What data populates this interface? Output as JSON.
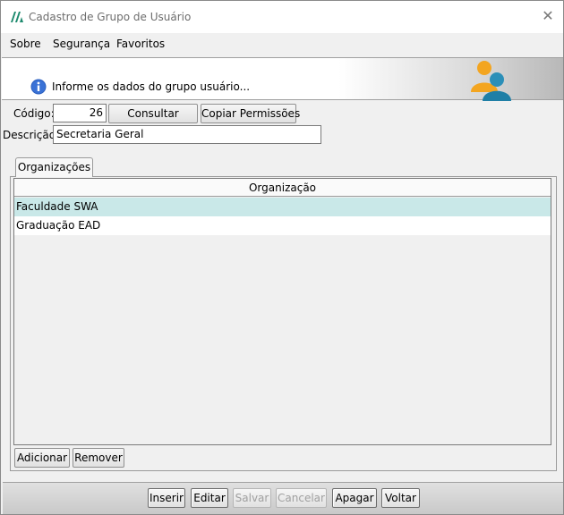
{
  "window": {
    "title": "Cadastro de Grupo de Usuário"
  },
  "menu": [
    {
      "label": "Sobre"
    },
    {
      "label": "Segurança"
    },
    {
      "label": "Favoritos"
    }
  ],
  "banner": {
    "text": "Informe os dados do grupo usuário..."
  },
  "form": {
    "codigo_label": "Código:",
    "codigo_value": "26",
    "consultar_label": "Consultar",
    "copiar_label": "Copiar Permissões",
    "descricao_label": "Descrição:",
    "descricao_value": "Secretaria Geral"
  },
  "tabs": [
    {
      "label": "Organizações"
    }
  ],
  "grid": {
    "column": "Organização",
    "rows": [
      {
        "name": "Faculdade SWA",
        "selected": true
      },
      {
        "name": "Graduação EAD",
        "selected": false
      }
    ]
  },
  "grid_buttons": {
    "add_label": "Adicionar",
    "remove_label": "Remover"
  },
  "actions": {
    "inserir": "Inserir",
    "editar": "Editar",
    "salvar": "Salvar",
    "cancelar": "Cancelar",
    "apagar": "Apagar",
    "voltar": "Voltar"
  },
  "colors": {
    "selected_row": "#c9e8e8",
    "logo": "#1e8a6e"
  },
  "icons": [
    "app-logo-icon",
    "close-icon",
    "info-icon",
    "users-icon"
  ]
}
